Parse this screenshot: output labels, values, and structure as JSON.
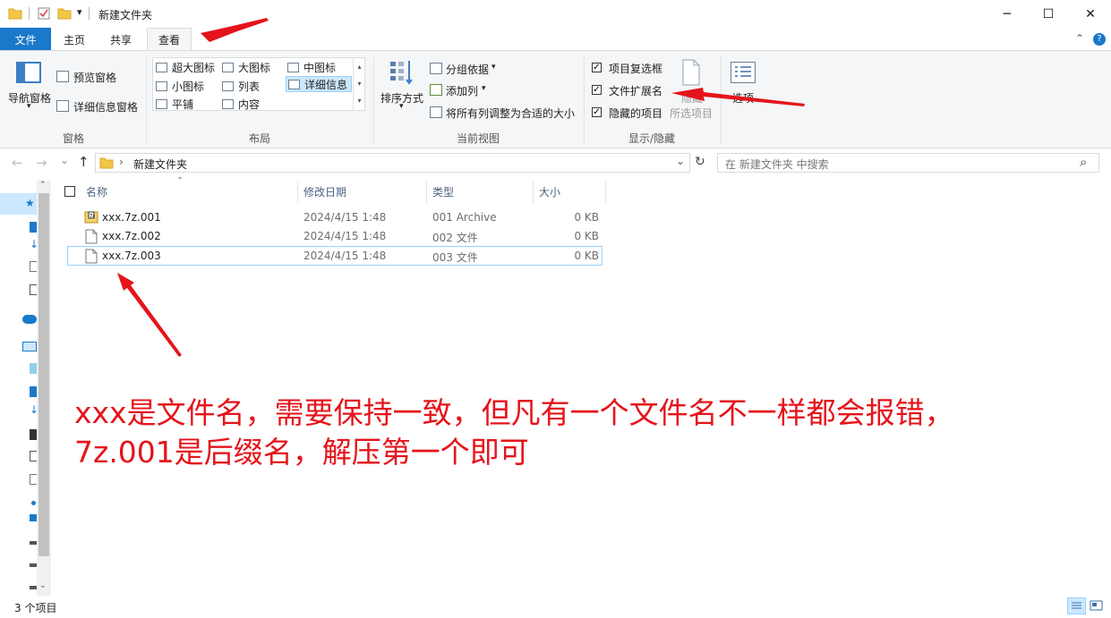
{
  "window": {
    "title": "新建文件夹",
    "minimize_glyph": "─",
    "maximize_glyph": "☐",
    "close_glyph": "✕",
    "qa_dropdown_glyph": "▾"
  },
  "tabs": [
    {
      "label": "文件"
    },
    {
      "label": "主页"
    },
    {
      "label": "共享"
    },
    {
      "label": "查看"
    }
  ],
  "ribbon": {
    "pane": {
      "nav_pane_label": "导航窗格",
      "preview_label": "预览窗格",
      "details_label": "详细信息窗格",
      "group_label": "窗格"
    },
    "layout": {
      "items": [
        "超大图标",
        "大图标",
        "中图标",
        "小图标",
        "列表",
        "详细信息",
        "平铺",
        "内容"
      ],
      "selected": "详细信息",
      "group_label": "布局"
    },
    "current_view": {
      "sort_label": "排序方式",
      "group_by_label": "分组依据",
      "add_column_label": "添加列",
      "fit_columns_label": "将所有列调整为合适的大小",
      "group_label": "当前视图"
    },
    "show_hide": {
      "item_checkboxes_label": "项目复选框",
      "file_extensions_label": "文件扩展名",
      "hidden_items_label": "隐藏的项目",
      "hide_selected_label": "隐藏",
      "hide_selected_label2": "所选项目",
      "group_label": "显示/隐藏",
      "check_glyph": "✓"
    },
    "options_label": "选项"
  },
  "address": {
    "path": "新建文件夹",
    "search_placeholder": "在 新建文件夹 中搜索",
    "back_glyph": "←",
    "forward_glyph": "→",
    "recent_glyph": "⌄",
    "up_glyph": "↑",
    "sep_glyph": "›",
    "dropdown_glyph": "⌄",
    "refresh_glyph": "↻",
    "search_glyph": "⌕",
    "help_glyph": "?"
  },
  "columns": [
    "名称",
    "修改日期",
    "类型",
    "大小"
  ],
  "files": [
    {
      "name": "xxx.7z.001",
      "date": "2024/4/15 1:48",
      "type": "001 Archive",
      "size": "0 KB",
      "icon": "archive-icon"
    },
    {
      "name": "xxx.7z.002",
      "date": "2024/4/15 1:48",
      "type": "002 文件",
      "size": "0 KB",
      "icon": "file-icon"
    },
    {
      "name": "xxx.7z.003",
      "date": "2024/4/15 1:48",
      "type": "003 文件",
      "size": "0 KB",
      "icon": "file-icon"
    }
  ],
  "status": {
    "count_text": "3 个项目"
  },
  "annotation": {
    "line1": "xxx是文件名，需要保持一致，但凡有一个文件名不一样都会报错，",
    "line2": "7z.001是后缀名，解压第一个即可"
  },
  "colors": {
    "accent": "#1979ca",
    "annotation": "#e5141b",
    "selection": "#cce8ff"
  }
}
